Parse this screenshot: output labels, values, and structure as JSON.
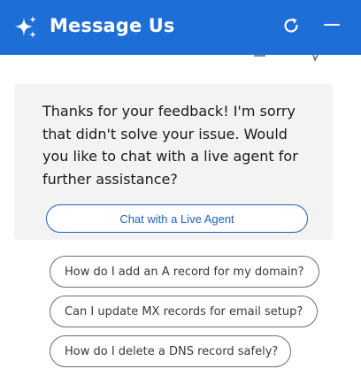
{
  "header": {
    "title": "Message Us",
    "background": "#1e6ed8",
    "icons": [
      "sparkle-icon",
      "refresh-icon",
      "minimize-icon"
    ]
  },
  "bot_message": {
    "text": "Thanks for your feedback! I'm sorry that didn't solve your issue. Would you like to chat with a live agent for further assistance?",
    "action_label": "Chat with a Live Agent",
    "action_color": "#1e5fc0"
  },
  "suggestions": [
    {
      "label": "How do I add an A record for my domain?"
    },
    {
      "label": "Can I update MX records for email setup?"
    },
    {
      "label": "How do I delete a DNS record safely?"
    }
  ]
}
